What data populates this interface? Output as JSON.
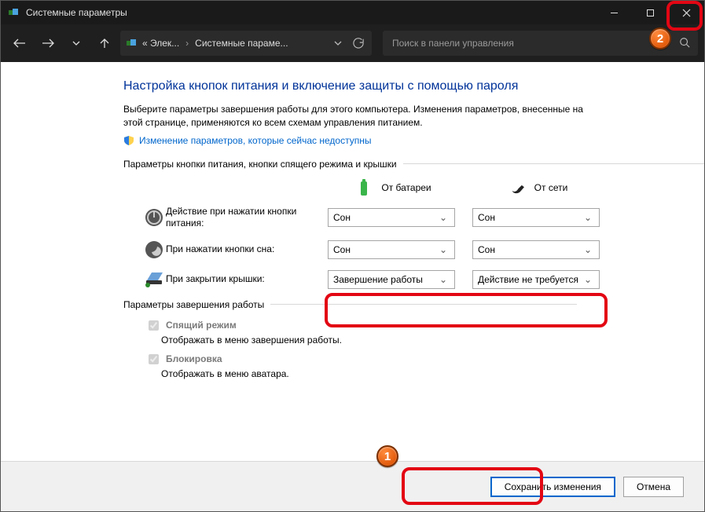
{
  "titlebar": {
    "title": "Системные параметры"
  },
  "nav": {
    "crumb1": "« Элек...",
    "crumb2": "Системные параме...",
    "search_placeholder": "Поиск в панели управления"
  },
  "page": {
    "heading": "Настройка кнопок питания и включение защиты с помощью пароля",
    "intro": "Выберите параметры завершения работы для этого компьютера. Изменения параметров, внесенные на этой странице, применяются ко всем схемам управления питанием.",
    "uac_link": "Изменение параметров, которые сейчас недоступны",
    "section1": "Параметры кнопки питания, кнопки спящего режима и крышки",
    "col_battery": "От батареи",
    "col_ac": "От сети",
    "row_power": "Действие при нажатии кнопки питания:",
    "row_sleep": "При нажатии кнопки сна:",
    "row_lid": "При закрытии крышки:",
    "section2": "Параметры завершения работы",
    "opt_sleep": "Спящий режим",
    "opt_sleep_desc": "Отображать в меню завершения работы.",
    "opt_lock": "Блокировка",
    "opt_lock_desc": "Отображать в меню аватара."
  },
  "selects": {
    "power_battery": "Сон",
    "power_ac": "Сон",
    "sleep_battery": "Сон",
    "sleep_ac": "Сон",
    "lid_battery": "Завершение работы",
    "lid_ac": "Действие не требуется"
  },
  "footer": {
    "save": "Сохранить изменения",
    "cancel": "Отмена"
  },
  "badges": {
    "b1": "1",
    "b2": "2"
  }
}
